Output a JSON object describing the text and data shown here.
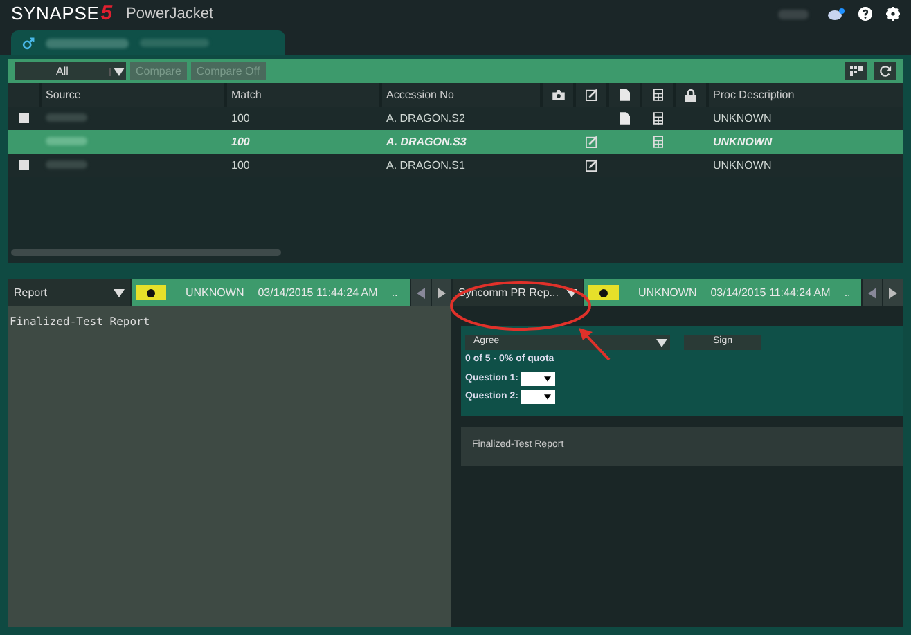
{
  "app": {
    "brand": "SYNAPSE",
    "brand_mark": "5",
    "product": "PowerJacket"
  },
  "toolbar": {
    "filter": "All",
    "buttons": [
      {
        "label": "Compare",
        "disabled": true
      },
      {
        "label": "Compare Off",
        "disabled": true
      }
    ]
  },
  "table": {
    "columns": [
      "Source",
      "Match",
      "Accession No",
      "Proc Description"
    ],
    "rows": [
      {
        "match": "100",
        "accession": "A. DRAGON.S2",
        "description": "UNKNOWN",
        "selected": false,
        "checked": false,
        "has_document": true,
        "has_edit": false,
        "has_layout": true
      },
      {
        "match": "100",
        "accession": "A. DRAGON.S3",
        "description": "UNKNOWN",
        "selected": true,
        "checked": false,
        "has_document": false,
        "has_edit": true,
        "has_layout": true
      },
      {
        "match": "100",
        "accession": "A. DRAGON.S1",
        "description": "UNKNOWN",
        "selected": false,
        "checked": false,
        "has_document": false,
        "has_edit": true,
        "has_layout": false
      }
    ]
  },
  "left_pane": {
    "report_select": "Report",
    "status": "UNKNOWN",
    "datetime": "03/14/2015 11:44:24 AM",
    "more": "..",
    "body": "Finalized-Test Report"
  },
  "right_pane": {
    "report_select": "Syncomm PR Rep...",
    "status": "UNKNOWN",
    "datetime": "03/14/2015 11:44:24 AM",
    "more": "..",
    "agree_select": "Agree",
    "sign_button": "Sign",
    "quota": "0 of 5 - 0% of quota",
    "questions": [
      "Question 1:",
      "Question 2:"
    ],
    "report_text": "Finalized-Test Report"
  }
}
